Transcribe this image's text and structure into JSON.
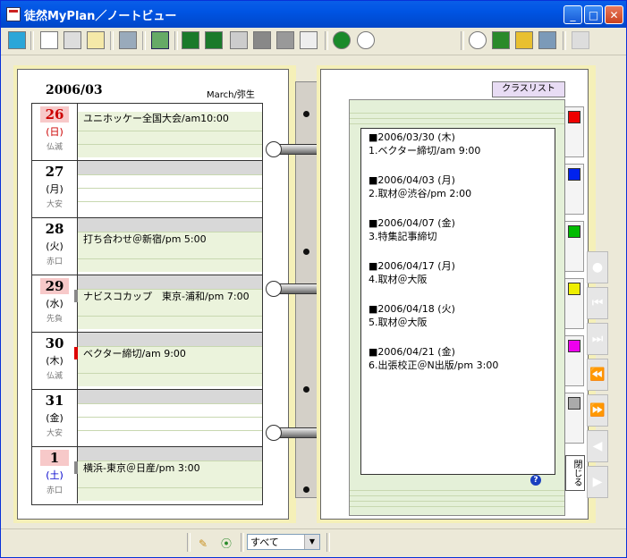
{
  "window": {
    "title": "徒然MyPlan／ノートビュー",
    "minimize": "_",
    "maximize": "□",
    "close": "✕"
  },
  "left_page": {
    "month": "2006/03",
    "month_en": "March/弥生",
    "days": [
      {
        "num": "26",
        "weekday": "(日)",
        "rokuyo": "仏滅",
        "event": "ユニホッケー全国大会/am10:00",
        "highlight": true,
        "weekday_color": "#cc0000",
        "mark_color": ""
      },
      {
        "num": "27",
        "weekday": "(月)",
        "rokuyo": "大安",
        "event": "",
        "highlight": false,
        "weekday_color": "#000000",
        "mark_color": ""
      },
      {
        "num": "28",
        "weekday": "(火)",
        "rokuyo": "赤口",
        "event": "打ち合わせ＠新宿/pm 5:00",
        "highlight": false,
        "weekday_color": "#000000",
        "mark_color": ""
      },
      {
        "num": "29",
        "weekday": "(水)",
        "rokuyo": "先負",
        "event": "ナビスコカップ　東京-浦和/pm 7:00",
        "highlight": true,
        "weekday_color": "#000000",
        "mark_color": "#888888"
      },
      {
        "num": "30",
        "weekday": "(木)",
        "rokuyo": "仏滅",
        "event": "ベクター締切/am 9:00",
        "highlight": false,
        "weekday_color": "#000000",
        "mark_color": "#dd0000"
      },
      {
        "num": "31",
        "weekday": "(金)",
        "rokuyo": "大安",
        "event": "",
        "highlight": false,
        "weekday_color": "#000000",
        "mark_color": ""
      },
      {
        "num": "1",
        "weekday": "(土)",
        "rokuyo": "赤口",
        "event": "横浜-東京＠日産/pm 3:00",
        "highlight": true,
        "weekday_color": "#0000cc",
        "mark_color": "#888888"
      }
    ]
  },
  "right_page": {
    "class_list": "クラスリスト",
    "tasks": [
      {
        "date": "■2006/03/30 (木)",
        "text": "1.ベクター締切/am 9:00"
      },
      {
        "date": "■2006/04/03 (月)",
        "text": "2.取材＠渋谷/pm 2:00"
      },
      {
        "date": "■2006/04/07 (金)",
        "text": "3.特集記事締切"
      },
      {
        "date": "■2006/04/17 (月)",
        "text": "4.取材＠大阪"
      },
      {
        "date": "■2006/04/18 (火)",
        "text": "5.取材＠大阪"
      },
      {
        "date": "■2006/04/21 (金)",
        "text": "6.出張校正＠N出版/pm 3:00"
      }
    ],
    "tab_colors": [
      "#ee0000",
      "#0022ee",
      "#00bb00",
      "#eeee00",
      "#ee00ee",
      "#aaaaaa"
    ],
    "close_label": "閉じる",
    "help": "?"
  },
  "status": {
    "filter_value": "すべて"
  }
}
